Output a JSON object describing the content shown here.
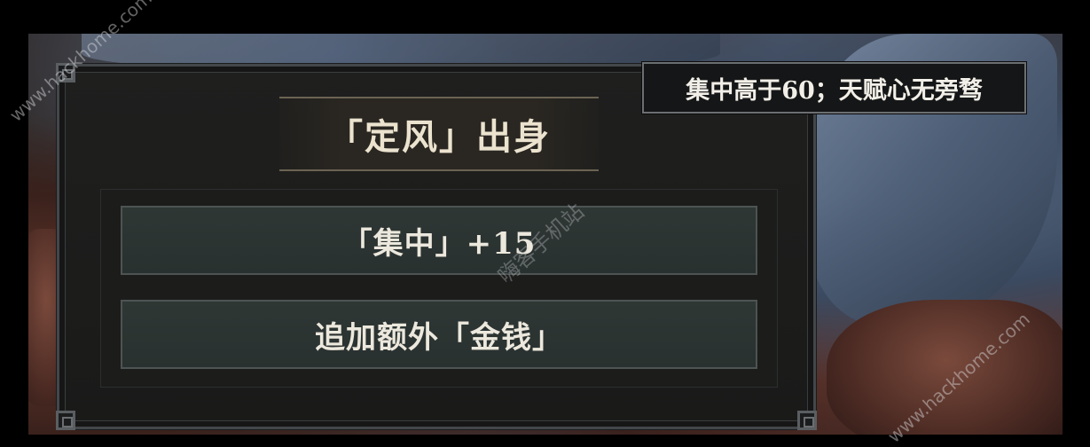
{
  "tooltip": {
    "text": "集中高于60；天赋心无旁骛"
  },
  "panel": {
    "title": "「定风」出身",
    "options": [
      {
        "label": "「集中」+15"
      },
      {
        "label": "追加额外「金钱」"
      }
    ]
  },
  "watermarks": {
    "site": "www.hackhome.com",
    "brand": "嗨客手机站"
  },
  "colors": {
    "title_text": "#ece3cf",
    "option_bg": "#2f3735",
    "panel_bg": "#1f1f1e",
    "tooltip_bg": "#151617"
  }
}
